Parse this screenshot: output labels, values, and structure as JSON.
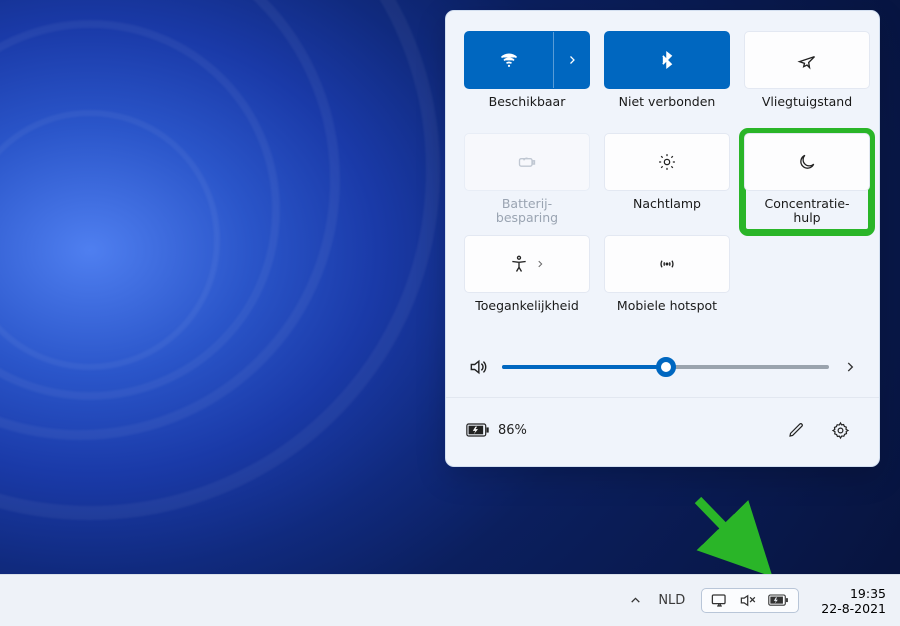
{
  "quick_settings": {
    "tiles": [
      {
        "id": "wifi",
        "label": "Beschikbaar",
        "active": true,
        "split": true
      },
      {
        "id": "bluetooth",
        "label": "Niet verbonden",
        "active": true
      },
      {
        "id": "airplane",
        "label": "Vliegtuigstand",
        "active": false
      },
      {
        "id": "battery-saver",
        "label": "Batterij-\nbesparing",
        "disabled": true
      },
      {
        "id": "nightlight",
        "label": "Nachtlamp",
        "active": false
      },
      {
        "id": "focus-assist",
        "label": "Concentratie-\nhulp",
        "active": false,
        "highlighted": true
      },
      {
        "id": "accessibility",
        "label": "Toegankelijkheid",
        "active": false,
        "split": true
      },
      {
        "id": "hotspot",
        "label": "Mobiele hotspot",
        "active": false
      }
    ],
    "volume_percent": 50,
    "battery_text": "86%"
  },
  "taskbar": {
    "language": "NLD",
    "time": "19:35",
    "date": "22-8-2021"
  },
  "colors": {
    "accent": "#0067c0",
    "highlight": "#2ab528"
  }
}
